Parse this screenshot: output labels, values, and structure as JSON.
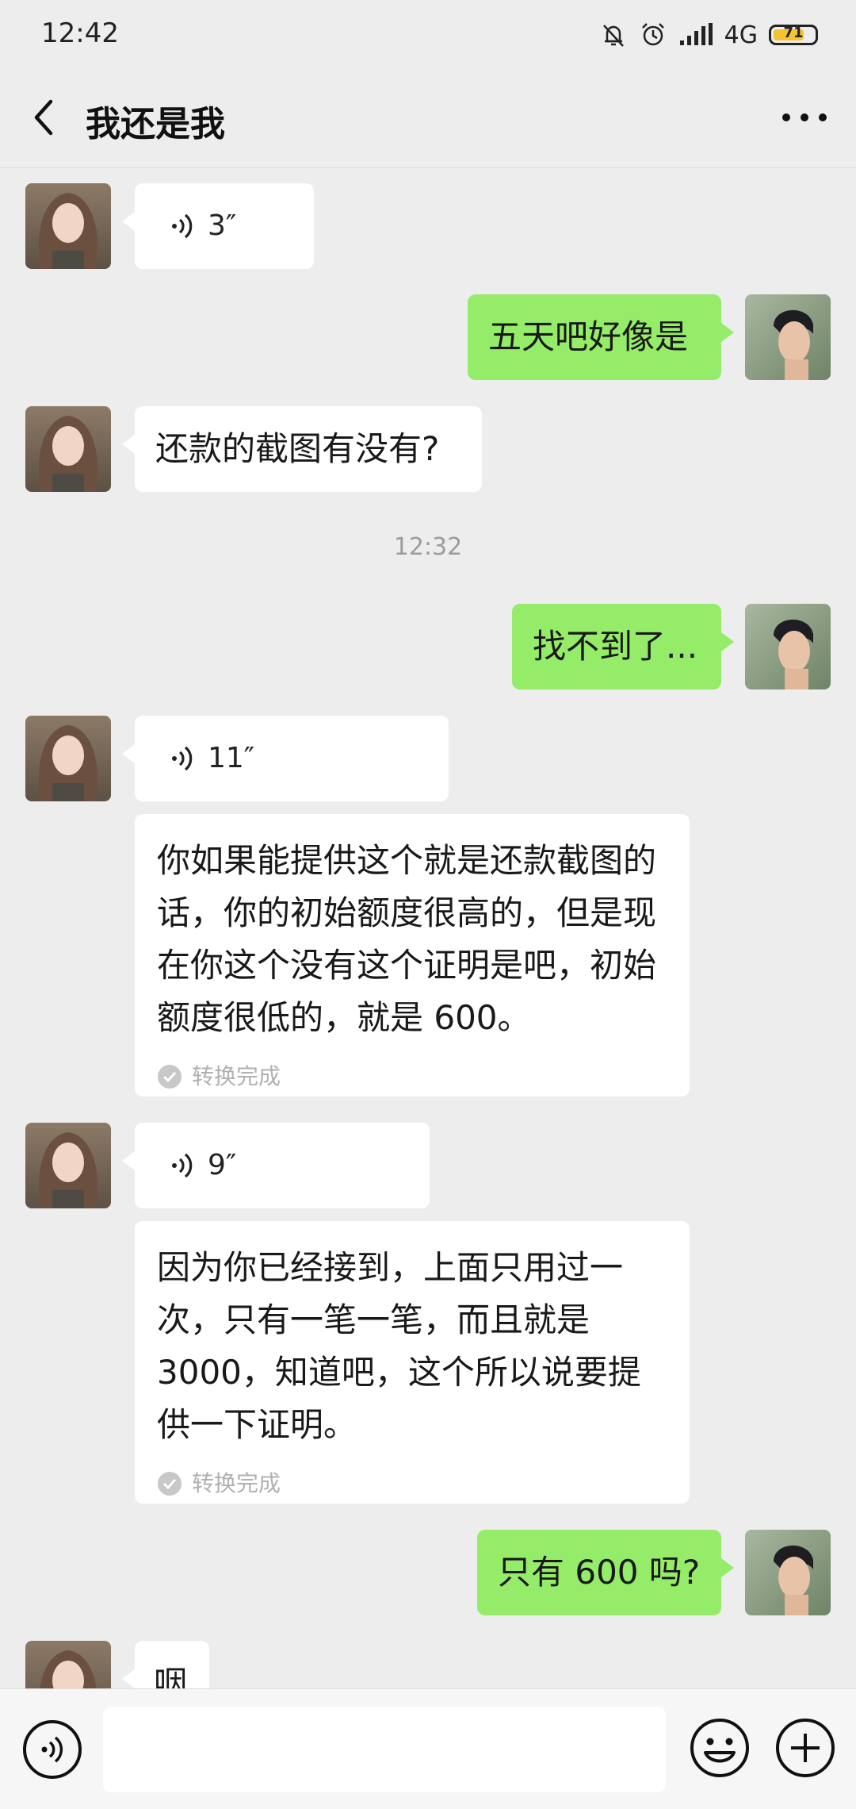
{
  "status_bar": {
    "time": "12:42",
    "network": "4G",
    "battery": "71"
  },
  "header": {
    "title": "我还是我"
  },
  "messages": {
    "m1": {
      "duration": "3″"
    },
    "m2": {
      "text": "五天吧好像是"
    },
    "m3": {
      "text": "还款的截图有没有?"
    },
    "time_divider": "12:32",
    "m4": {
      "text": "找不到了..."
    },
    "m5": {
      "duration": "11″",
      "transcript": "你如果能提供这个就是还款截图的话，你的初始额度很高的，但是现在你这个没有这个证明是吧，初始额度很低的，就是 600。",
      "status": "转换完成"
    },
    "m6": {
      "duration": "9″",
      "transcript": "因为你已经接到，上面只用过一次，只有一笔一笔，而且就是 3000，知道吧，这个所以说要提供一下证明。",
      "status": "转换完成"
    },
    "m7": {
      "text": "只有 600 吗?"
    },
    "m8": {
      "text": "咽"
    }
  },
  "icons": {
    "back": "chevron-left-icon",
    "more": "more-dots-icon",
    "voice": "voice-wave-icon",
    "emoji": "smiley-icon",
    "plus": "plus-circle-icon",
    "check": "check-circle-icon"
  },
  "colors": {
    "sent_bubble": "#95ec69",
    "received_bubble": "#ffffff",
    "background": "#ededed"
  }
}
